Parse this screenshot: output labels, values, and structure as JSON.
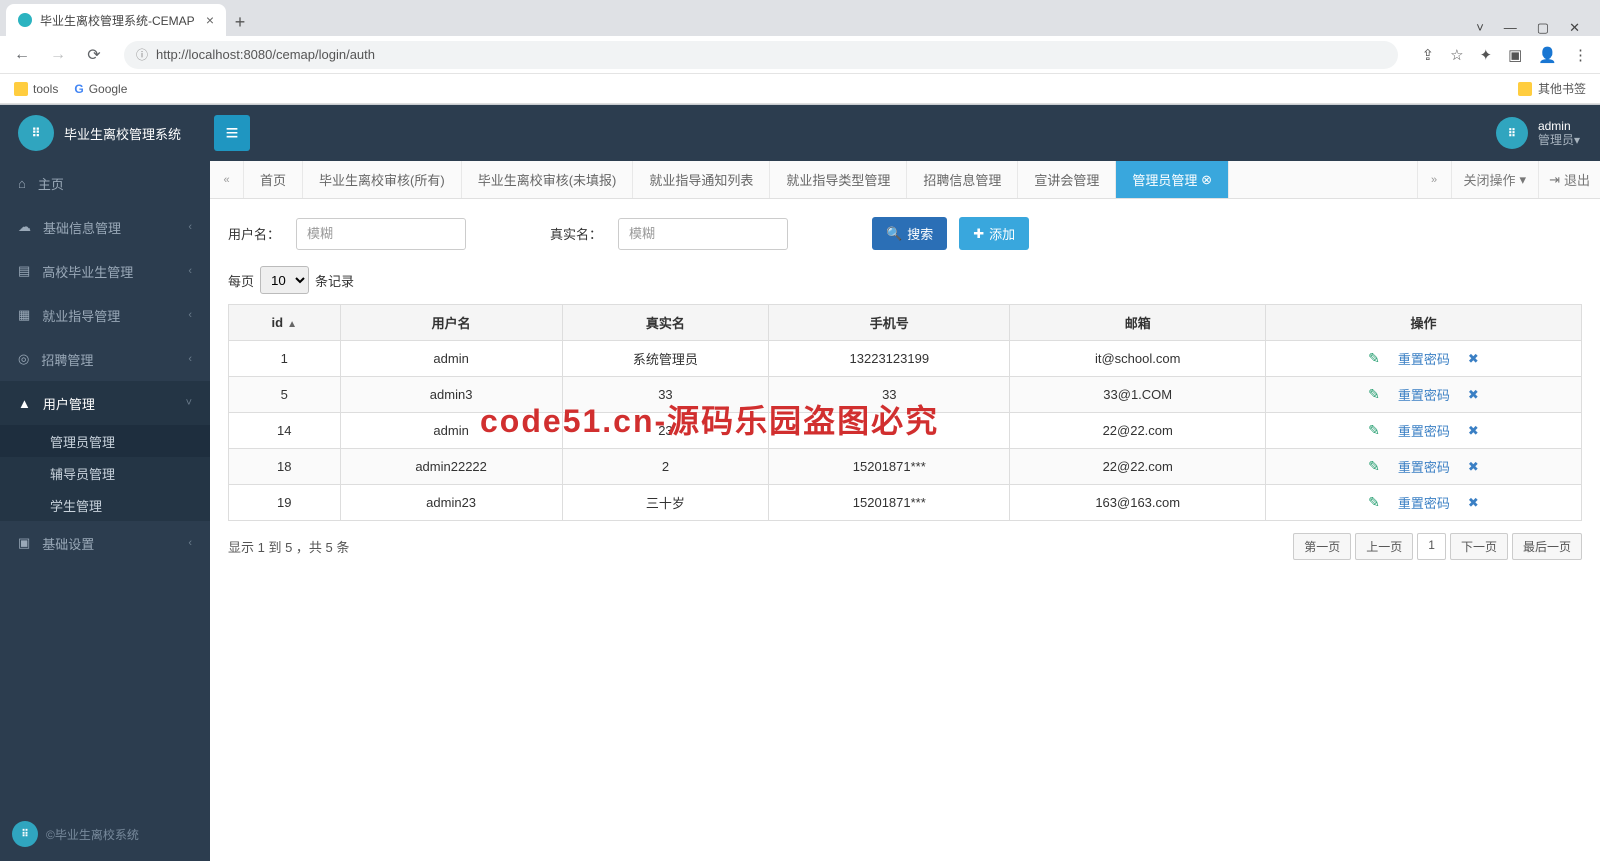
{
  "browser": {
    "tab_title": "毕业生离校管理系统-CEMAP",
    "url": "http://localhost:8080/cemap/login/auth",
    "bookmarks": {
      "tools": "tools",
      "google": "Google",
      "other": "其他书签"
    }
  },
  "header": {
    "app_name": "毕业生离校管理系统",
    "user_name": "admin",
    "user_role": "管理员"
  },
  "sidebar": {
    "items": [
      {
        "icon": "home",
        "label": "主页"
      },
      {
        "icon": "db",
        "label": "基础信息管理"
      },
      {
        "icon": "book",
        "label": "高校毕业生管理"
      },
      {
        "icon": "guide",
        "label": "就业指导管理"
      },
      {
        "icon": "job",
        "label": "招聘管理"
      },
      {
        "icon": "user",
        "label": "用户管理"
      },
      {
        "icon": "cog",
        "label": "基础设置"
      }
    ],
    "subitems": [
      "管理员管理",
      "辅导员管理",
      "学生管理"
    ],
    "footer": "©毕业生离校系统"
  },
  "tabs": {
    "list": [
      "首页",
      "毕业生离校审核(所有)",
      "毕业生离校审核(未填报)",
      "就业指导通知列表",
      "就业指导类型管理",
      "招聘信息管理",
      "宣讲会管理",
      "管理员管理"
    ],
    "close_op": "关闭操作",
    "logout": "退出"
  },
  "filters": {
    "username_label": "用户名：",
    "realname_label": "真实名：",
    "placeholder": "模糊",
    "search_btn": "搜索",
    "add_btn": "添加"
  },
  "records": {
    "per_page_pre": "每页",
    "per_page_val": "10",
    "per_page_suf": "条记录"
  },
  "table": {
    "headers": [
      "id",
      "用户名",
      "真实名",
      "手机号",
      "邮箱",
      "操作"
    ],
    "op_reset": "重置密码",
    "rows": [
      {
        "id": "1",
        "username": "admin",
        "realname": "系统管理员",
        "phone": "13223123199",
        "email": "it@school.com"
      },
      {
        "id": "5",
        "username": "admin3",
        "realname": "33",
        "phone": "33",
        "email": "33@1.COM"
      },
      {
        "id": "14",
        "username": "admin",
        "realname": "23",
        "phone": "",
        "email": "22@22.com"
      },
      {
        "id": "18",
        "username": "admin22222",
        "realname": "2",
        "phone": "15201871***",
        "email": "22@22.com"
      },
      {
        "id": "19",
        "username": "admin23",
        "realname": "三十岁",
        "phone": "15201871***",
        "email": "163@163.com"
      }
    ]
  },
  "pager": {
    "info": "显示 1 到 5 ，共 5 条",
    "first": "第一页",
    "prev": "上一页",
    "cur": "1",
    "next": "下一页",
    "last": "最后一页"
  },
  "watermark": {
    "text": "code51.cn",
    "red": "code51.cn-源码乐园盗图必究"
  }
}
